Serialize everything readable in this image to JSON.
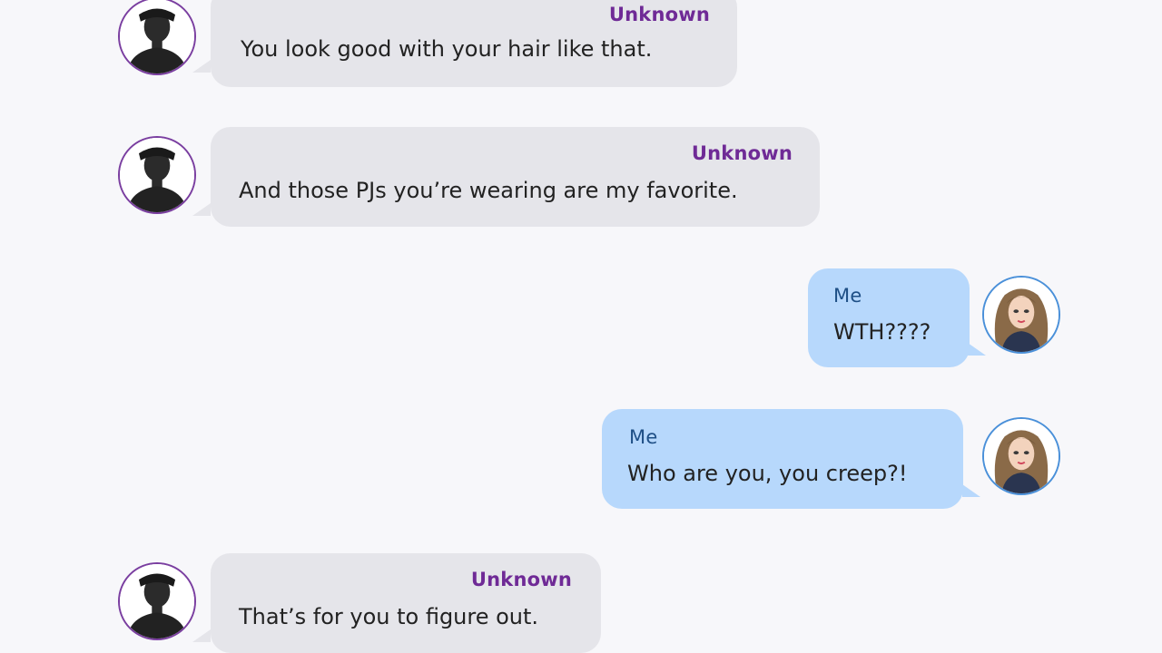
{
  "conversation": {
    "messages": [
      {
        "direction": "incoming",
        "sender": "Unknown",
        "text": "You look good with your hair like that.",
        "avatar_icon": "silhouette-avatar-icon"
      },
      {
        "direction": "incoming",
        "sender": "Unknown",
        "text": "And those PJs you’re wearing are my favorite.",
        "avatar_icon": "silhouette-avatar-icon"
      },
      {
        "direction": "outgoing",
        "sender": "Me",
        "text": "WTH????",
        "avatar_icon": "girl-avatar-icon"
      },
      {
        "direction": "outgoing",
        "sender": "Me",
        "text": "Who are you, you creep?!",
        "avatar_icon": "girl-avatar-icon"
      },
      {
        "direction": "incoming",
        "sender": "Unknown",
        "text": "That’s for you to figure out.",
        "avatar_icon": "silhouette-avatar-icon"
      }
    ]
  },
  "colors": {
    "background": "#f7f7fa",
    "incoming_bubble": "#e5e5ea",
    "outgoing_bubble": "#b7d8fc",
    "incoming_sender": "#6f2a96",
    "outgoing_sender": "#1e4f86"
  }
}
